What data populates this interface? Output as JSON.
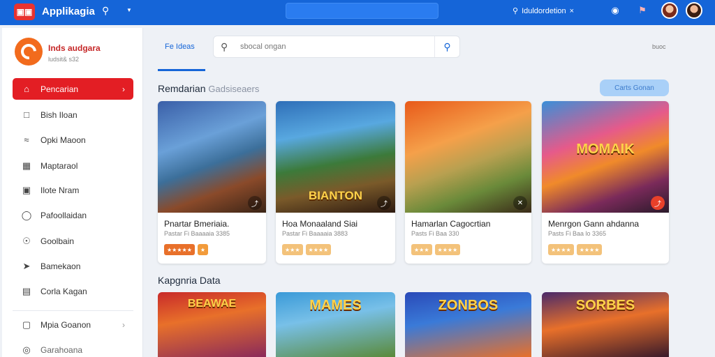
{
  "app": {
    "logo_text": "▣▣",
    "title": "Applikagia"
  },
  "topbar": {
    "link_label": "Iduldordetion",
    "link_chevron": "×"
  },
  "profile": {
    "name": "Inds audgara",
    "subtitle": "ludsit& s32"
  },
  "sidebar": {
    "items": [
      {
        "label": "Pencarian",
        "icon": "home-icon"
      },
      {
        "label": "Bish Iloan",
        "icon": "file-icon"
      },
      {
        "label": "Opki Maoon",
        "icon": "wifi-icon"
      },
      {
        "label": "Maptaraol",
        "icon": "calendar-icon"
      },
      {
        "label": "Ilote Nram",
        "icon": "doc-icon"
      },
      {
        "label": "Pafoollaidan",
        "icon": "comment-icon"
      },
      {
        "label": "Goolbain",
        "icon": "info-icon"
      },
      {
        "label": "Bamekaon",
        "icon": "signpost-icon"
      },
      {
        "label": "Corla Kagan",
        "icon": "bag-icon"
      }
    ],
    "extra": [
      {
        "label": "Mpia Goanon",
        "icon": "box-icon"
      },
      {
        "label": "Garahoana",
        "icon": "circle-icon"
      }
    ]
  },
  "main": {
    "tab_label": "Fe Ideas",
    "search_placeholder": "sbocal ongan",
    "right_note": "buoc",
    "section1_title": "Remdarian",
    "section1_muted": "Gadsiseaers",
    "cta_label": "Carts Gonan",
    "section2_title": "Kapgnria Data"
  },
  "cards": [
    {
      "title": "Pnartar Bmeriaia.",
      "subtitle": "Pastar Fi Baaaaia 3385",
      "art_text": "",
      "rating": [
        "★★★★★",
        "★"
      ]
    },
    {
      "title": "Hoa Monaaland Siai",
      "subtitle": "Pastar Fi Baaaaia 3883",
      "art_text": "BIANTON",
      "rating": [
        "★★★",
        "★★★★"
      ]
    },
    {
      "title": "Hamarlan Cagocrtian",
      "subtitle": "Pasts Fi Baa 330",
      "art_text": "",
      "rating": [
        "★★★",
        "★★★★"
      ]
    },
    {
      "title": "Menrgon Gann ahdanna",
      "subtitle": "Pasts Fi Baa lo 3365",
      "art_text": "MOMAIK",
      "rating": [
        "★★★★",
        "★★★★"
      ]
    }
  ],
  "cards2": [
    {
      "art_text": "BEAWAE"
    },
    {
      "art_text": "MAMES"
    },
    {
      "art_text": "ZONBOS"
    },
    {
      "art_text": "SORBES"
    }
  ],
  "colors": {
    "primary": "#1565d8",
    "accent": "#e31e24"
  }
}
